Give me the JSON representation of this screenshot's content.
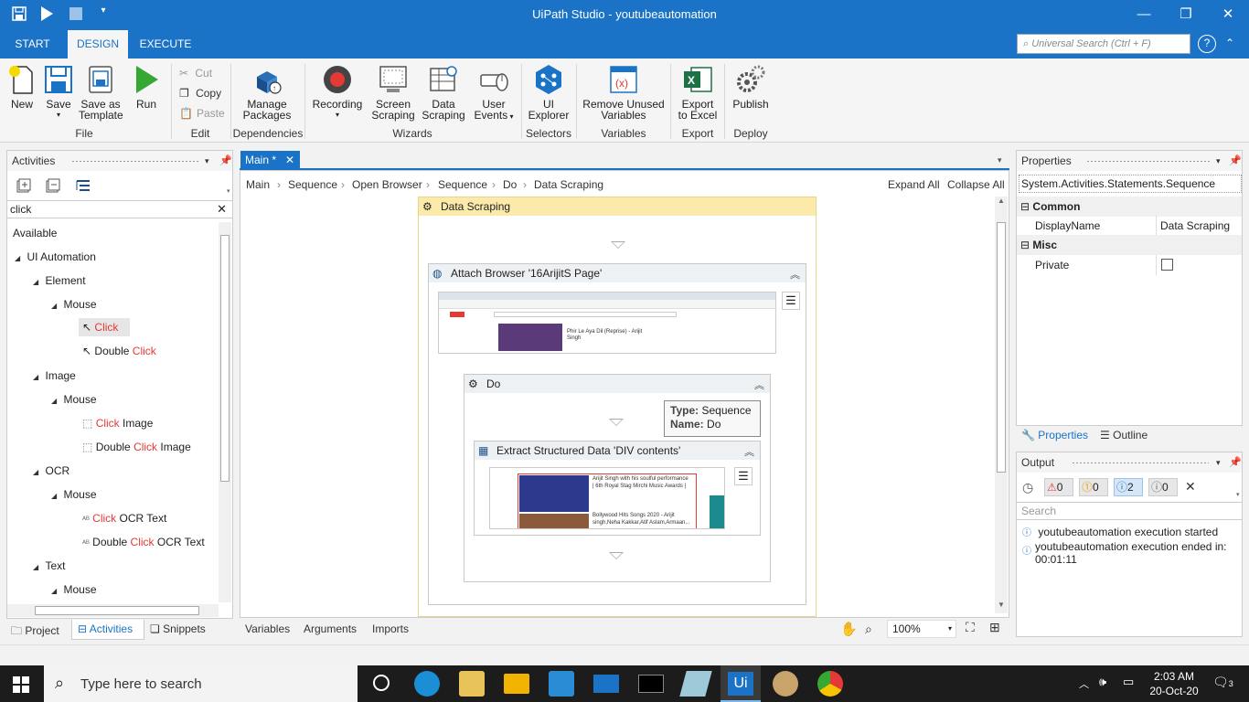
{
  "window": {
    "title": "UiPath Studio - youtubeautomation"
  },
  "ribbon_tabs": [
    "START",
    "DESIGN",
    "EXECUTE"
  ],
  "universal_search": {
    "placeholder": "Universal Search (Ctrl + F)"
  },
  "help": "?",
  "ribbon": {
    "file": {
      "group": "File",
      "new": "New",
      "save": "Save",
      "save_template_1": "Save as",
      "save_template_2": "Template",
      "run": "Run"
    },
    "edit": {
      "group": "Edit",
      "cut": "Cut",
      "copy": "Copy",
      "paste": "Paste"
    },
    "dependencies": {
      "group": "Dependencies",
      "manage_1": "Manage",
      "manage_2": "Packages"
    },
    "wizards": {
      "group": "Wizards",
      "recording": "Recording",
      "screen_1": "Screen",
      "screen_2": "Scraping",
      "data_1": "Data",
      "data_2": "Scraping",
      "user_1": "User",
      "user_2": "Events"
    },
    "selectors": {
      "group": "Selectors",
      "ui_1": "UI",
      "ui_2": "Explorer"
    },
    "variables": {
      "group": "Variables",
      "remove_1": "Remove Unused",
      "remove_2": "Variables"
    },
    "export": {
      "group": "Export",
      "excel_1": "Export",
      "excel_2": "to Excel"
    },
    "deploy": {
      "group": "Deploy",
      "publish": "Publish"
    }
  },
  "activities": {
    "title": "Activities",
    "search_value": "click",
    "tree": {
      "available": "Available",
      "ui_automation": "UI Automation",
      "element": "Element",
      "mouse1": "Mouse",
      "click": "Click",
      "double": "Double ",
      "click2": "Click",
      "image": "Image",
      "mouse2": "Mouse",
      "click_image_a": "Click",
      "click_image_b": " Image",
      "dbl_image_a": "Double ",
      "dbl_image_b": "Click",
      "dbl_image_c": " Image",
      "ocr": "OCR",
      "mouse3": "Mouse",
      "click_ocr_a": "Click",
      "click_ocr_b": " OCR Text",
      "dbl_ocr_a": "Double ",
      "dbl_ocr_b": "Click",
      "dbl_ocr_c": " OCR Text",
      "text": "Text",
      "mouse4": "Mouse"
    }
  },
  "bottom_left_tabs": {
    "project": "Project",
    "activities": "Activities",
    "snippets": "Snippets"
  },
  "designer": {
    "doc_tab": "Main *",
    "breadcrumb": [
      "Main",
      "Sequence",
      "Open Browser",
      "Sequence",
      "Do",
      "Data Scraping"
    ],
    "expand_all": "Expand All",
    "collapse_all": "Collapse All",
    "data_scraping": "Data Scraping",
    "attach_browser": "Attach Browser '16ArijitS Page'",
    "do": "Do",
    "tooltip": {
      "type_label": "Type:",
      "type_value": "Sequence",
      "name_label": "Name:",
      "name_value": "Do"
    },
    "extract": "Extract Structured Data 'DIV  contents'",
    "thumb_text_1": "Phir Le Aya Dil (Reprise) - Arijit",
    "thumb_text_2": "Singh",
    "thumb2_text_1": "Arijit Singh with his soulful performance",
    "thumb2_text_2": "| 6th Royal Stag Mirchi Music Awards |",
    "thumb2_text_3": "Bollywood Hits Songs 2020 - Arijit",
    "thumb2_text_4": "singh,Neha Kakkar,Atif Aslam,Armaan..."
  },
  "designer_bottom": {
    "variables": "Variables",
    "arguments": "Arguments",
    "imports": "Imports",
    "zoom": "100%"
  },
  "properties": {
    "title": "Properties",
    "type": "System.Activities.Statements.Sequence",
    "common": "Common",
    "display_name_label": "DisplayName",
    "display_name_value": "Data Scraping",
    "misc": "Misc",
    "private_label": "Private",
    "tab_properties": "Properties",
    "tab_outline": "Outline"
  },
  "output": {
    "title": "Output",
    "counts": {
      "errors": "0",
      "warnings": "0",
      "info": "2",
      "trace": "0"
    },
    "search_placeholder": "Search",
    "line1": "youtubeautomation execution started",
    "line2a": "youtubeautomation execution ended in:",
    "line2b": "00:01:11"
  },
  "taskbar": {
    "search": "Type here to search",
    "time": "2:03 AM",
    "date": "20-Oct-20",
    "notifications": "3"
  },
  "colors": {
    "accent": "#1a73c6",
    "highlight": "#e53935",
    "scraping_header": "#fbeaa9"
  }
}
